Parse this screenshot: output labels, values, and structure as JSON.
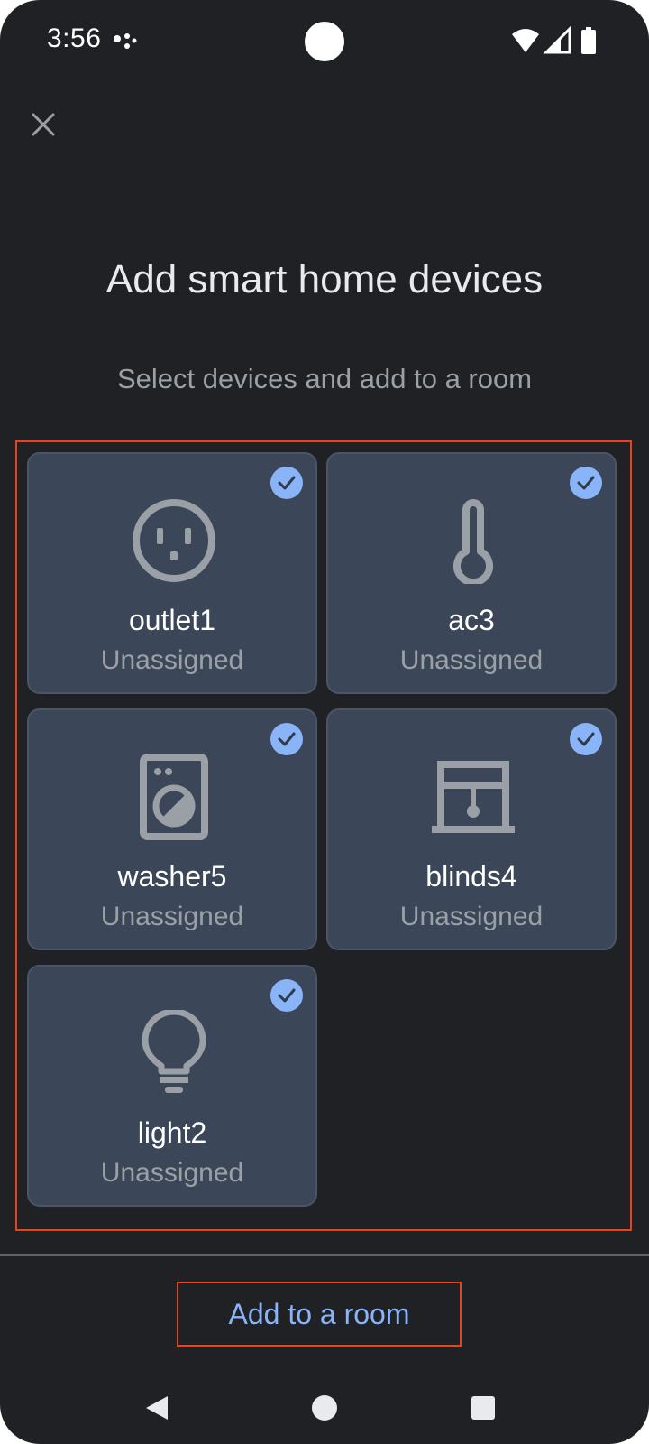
{
  "status_bar": {
    "time": "3:56"
  },
  "header": {
    "close_icon": "close-icon",
    "title": "Add smart home devices",
    "subtitle": "Select devices and add to a room"
  },
  "devices": [
    {
      "name": "outlet1",
      "room": "Unassigned",
      "icon": "outlet-icon",
      "selected": true
    },
    {
      "name": "ac3",
      "room": "Unassigned",
      "icon": "thermometer-icon",
      "selected": true
    },
    {
      "name": "washer5",
      "room": "Unassigned",
      "icon": "washer-icon",
      "selected": true
    },
    {
      "name": "blinds4",
      "room": "Unassigned",
      "icon": "blinds-icon",
      "selected": true
    },
    {
      "name": "light2",
      "room": "Unassigned",
      "icon": "lightbulb-icon",
      "selected": true
    }
  ],
  "footer": {
    "add_button_label": "Add to a room"
  },
  "colors": {
    "background": "#202124",
    "card": "#3b4658",
    "accent": "#8ab4f8",
    "highlight_border": "#e8431a",
    "icon_gray": "#9aa0a6"
  }
}
